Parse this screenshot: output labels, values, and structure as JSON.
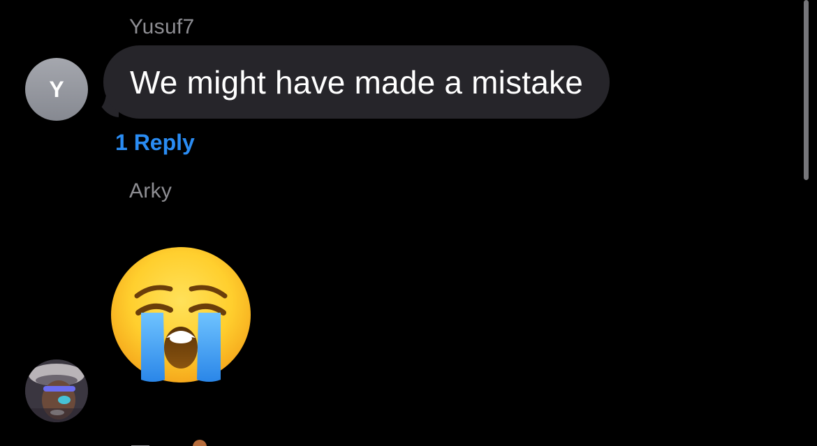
{
  "messages": [
    {
      "sender": "Yusuf7",
      "avatar_initial": "Y",
      "text": "We might have made a mistake",
      "reply_label": "1 Reply"
    },
    {
      "sender": "Arky",
      "content": "loudly-crying-face-emoji"
    }
  ],
  "colors": {
    "background": "#000000",
    "bubble": "#26252a",
    "sender_name": "#8e8e93",
    "reply_link": "#2a8cf3",
    "avatar_initial_bg": "#9a9ca3",
    "scrollbar": "#8b8b8f"
  },
  "icons": {
    "emoji": "loudly-crying-face",
    "avatar_photo": "user-photo-avatar"
  }
}
